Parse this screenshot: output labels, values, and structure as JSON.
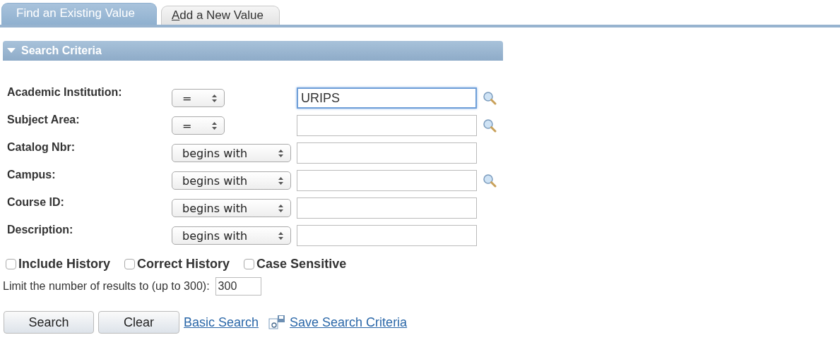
{
  "tabs": [
    {
      "label": "Find an Existing Value",
      "selected": true,
      "accesskey": false
    },
    {
      "label": "Add a New Value",
      "selected": false,
      "accesskey": true
    }
  ],
  "section": {
    "title": "Search Criteria",
    "expanded": true
  },
  "criteria": [
    {
      "label": "Academic Institution:",
      "operator": "=",
      "value": "URIPS",
      "focused": true,
      "lookup": true
    },
    {
      "label": "Subject Area:",
      "operator": "=",
      "focused": false,
      "lookup": true
    },
    {
      "label": "Catalog Nbr:",
      "operator": "begins with",
      "focused": false,
      "lookup": false
    },
    {
      "label": "Campus:",
      "operator": "begins with",
      "focused": false,
      "lookup": true
    },
    {
      "label": "Course ID:",
      "operator": "begins with",
      "focused": false,
      "lookup": false
    },
    {
      "label": "Description:",
      "operator": "begins with",
      "focused": false,
      "lookup": false
    }
  ],
  "options": [
    {
      "label": "Include History",
      "checked": false
    },
    {
      "label": "Correct History",
      "checked": false
    },
    {
      "label": "Case Sensitive",
      "checked": false
    }
  ],
  "limit": {
    "label": "Limit the number of results to (up to 300):",
    "value": "300"
  },
  "buttons": [
    "Search",
    "Clear"
  ],
  "links": [
    {
      "label": "Basic Search",
      "icon": false
    },
    {
      "label": "Save Search Criteria",
      "icon": true
    }
  ]
}
